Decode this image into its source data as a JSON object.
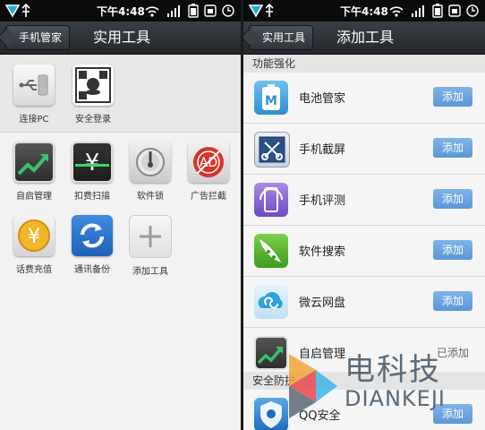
{
  "status": {
    "time": "下午4:48"
  },
  "left": {
    "back_label": "手机管家",
    "title": "实用工具",
    "top_tools": [
      {
        "label": "连接PC",
        "icon": "usb-icon"
      },
      {
        "label": "安全登录",
        "icon": "qr-login-icon"
      }
    ],
    "tools": [
      {
        "label": "自启管理",
        "icon": "autostart-chart-icon"
      },
      {
        "label": "扣费扫描",
        "icon": "yuan-scan-icon"
      },
      {
        "label": "软件锁",
        "icon": "lock-dial-icon"
      },
      {
        "label": "广告拦截",
        "icon": "ad-block-icon",
        "icon_text": "AD"
      },
      {
        "label": "话费充值",
        "icon": "yuan-coin-icon"
      },
      {
        "label": "通讯备份",
        "icon": "sync-backup-icon"
      },
      {
        "label": "添加工具",
        "icon": "plus-icon"
      }
    ]
  },
  "right": {
    "back_label": "实用工具",
    "title": "添加工具",
    "section1": "功能强化",
    "section2": "安全防护",
    "items": [
      {
        "name": "电池管家",
        "action": "添加",
        "icon": "battery-manager-icon"
      },
      {
        "name": "手机截屏",
        "action": "添加",
        "icon": "screenshot-scissors-icon"
      },
      {
        "name": "手机评测",
        "action": "添加",
        "icon": "phone-benchmark-icon"
      },
      {
        "name": "软件搜索",
        "action": "添加",
        "icon": "app-search-icon"
      },
      {
        "name": "微云网盘",
        "action": "添加",
        "icon": "weiyun-cloud-icon"
      },
      {
        "name": "自启管理",
        "action": "已添加",
        "icon": "autostart-chart-icon"
      }
    ],
    "security_items": [
      {
        "name": "QQ安全",
        "action": "添加",
        "icon": "qq-security-icon"
      }
    ]
  },
  "watermark": {
    "cn": "电科技",
    "en": "DIANKEJI"
  },
  "colors": {
    "add_button": "#5b97d6",
    "titlebar": "#2b3036",
    "statusbar": "#0b0b0b"
  }
}
